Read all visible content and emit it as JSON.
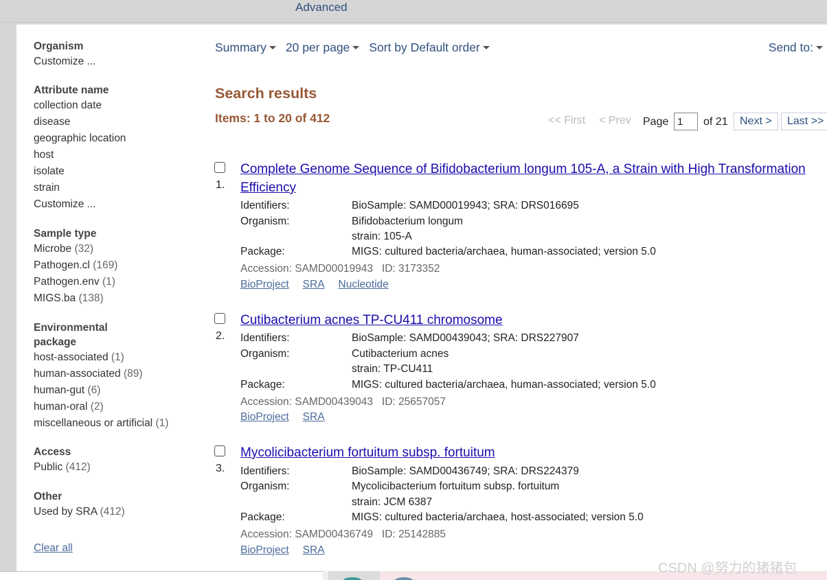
{
  "header": {
    "advanced_label": "Advanced"
  },
  "sidebar": {
    "organism": {
      "title": "Organism",
      "items": [
        {
          "label": "Customize ...",
          "count": ""
        }
      ]
    },
    "attribute": {
      "title": "Attribute name",
      "items": [
        {
          "label": "collection date",
          "count": ""
        },
        {
          "label": "disease",
          "count": ""
        },
        {
          "label": "geographic location",
          "count": ""
        },
        {
          "label": "host",
          "count": ""
        },
        {
          "label": "isolate",
          "count": ""
        },
        {
          "label": "strain",
          "count": ""
        },
        {
          "label": "Customize ...",
          "count": ""
        }
      ]
    },
    "sample_type": {
      "title": "Sample type",
      "items": [
        {
          "label": "Microbe",
          "count": "(32)"
        },
        {
          "label": "Pathogen.cl",
          "count": "(169)"
        },
        {
          "label": "Pathogen.env",
          "count": "(1)"
        },
        {
          "label": "MIGS.ba",
          "count": "(138)"
        }
      ]
    },
    "env_package": {
      "title_line1": "Environmental",
      "title_line2": "package",
      "items": [
        {
          "label": "host-associated",
          "count": "(1)"
        },
        {
          "label": "human-associated",
          "count": "(89)"
        },
        {
          "label": "human-gut",
          "count": "(6)"
        },
        {
          "label": "human-oral",
          "count": "(2)"
        },
        {
          "label": "miscellaneous or artificial",
          "count": "(1)"
        }
      ]
    },
    "access": {
      "title": "Access",
      "items": [
        {
          "label": "Public",
          "count": "(412)"
        }
      ]
    },
    "other": {
      "title": "Other",
      "items": [
        {
          "label": "Used by SRA",
          "count": "(412)"
        }
      ]
    },
    "clear_all": "Clear all"
  },
  "toolbar": {
    "summary": "Summary",
    "per_page": "20 per page",
    "sort": "Sort by Default order",
    "send_to": "Send to:"
  },
  "results_header": {
    "title": "Search results",
    "items": "Items: 1 to 20 of 412"
  },
  "pager": {
    "first": "<< First",
    "prev": "< Prev",
    "page_label": "Page",
    "page_value": "1",
    "of_label": "of 21",
    "next": "Next >",
    "last": "Last >>"
  },
  "labels": {
    "identifiers": "Identifiers:",
    "organism": "Organism:",
    "package": "Package:"
  },
  "results": [
    {
      "number": "1.",
      "title": "Complete Genome Sequence of Bifidobacterium longum 105-A, a Strain with High Transformation Efficiency",
      "identifiers": "BioSample: SAMD00019943; SRA: DRS016695",
      "organism": "Bifidobacterium longum",
      "strain": "strain: 105-A",
      "package": "MIGS: cultured bacteria/archaea, human-associated; version 5.0",
      "accession": "Accession: SAMD00019943   ID: 3173352",
      "links": [
        "BioProject",
        "SRA",
        "Nucleotide"
      ]
    },
    {
      "number": "2.",
      "title": "Cutibacterium acnes TP-CU411 chromosome",
      "identifiers": "BioSample: SAMD00439043; SRA: DRS227907",
      "organism": "Cutibacterium acnes",
      "strain": "strain: TP-CU411",
      "package": "MIGS: cultured bacteria/archaea, human-associated; version 5.0",
      "accession": "Accession: SAMD00439043   ID: 25657057",
      "links": [
        "BioProject",
        "SRA"
      ]
    },
    {
      "number": "3.",
      "title": "Mycolicibacterium fortuitum subsp. fortuitum",
      "identifiers": "BioSample: SAMD00436749; SRA: DRS224379",
      "organism": "Mycolicibacterium fortuitum subsp. fortuitum",
      "strain": "strain: JCM 6387",
      "package": "MIGS: cultured bacteria/archaea, host-associated; version 5.0",
      "accession": "Accession: SAMD00436749   ID: 25142885",
      "links": [
        "BioProject",
        "SRA"
      ]
    }
  ],
  "watermark": "CSDN @努力的猪猪包"
}
